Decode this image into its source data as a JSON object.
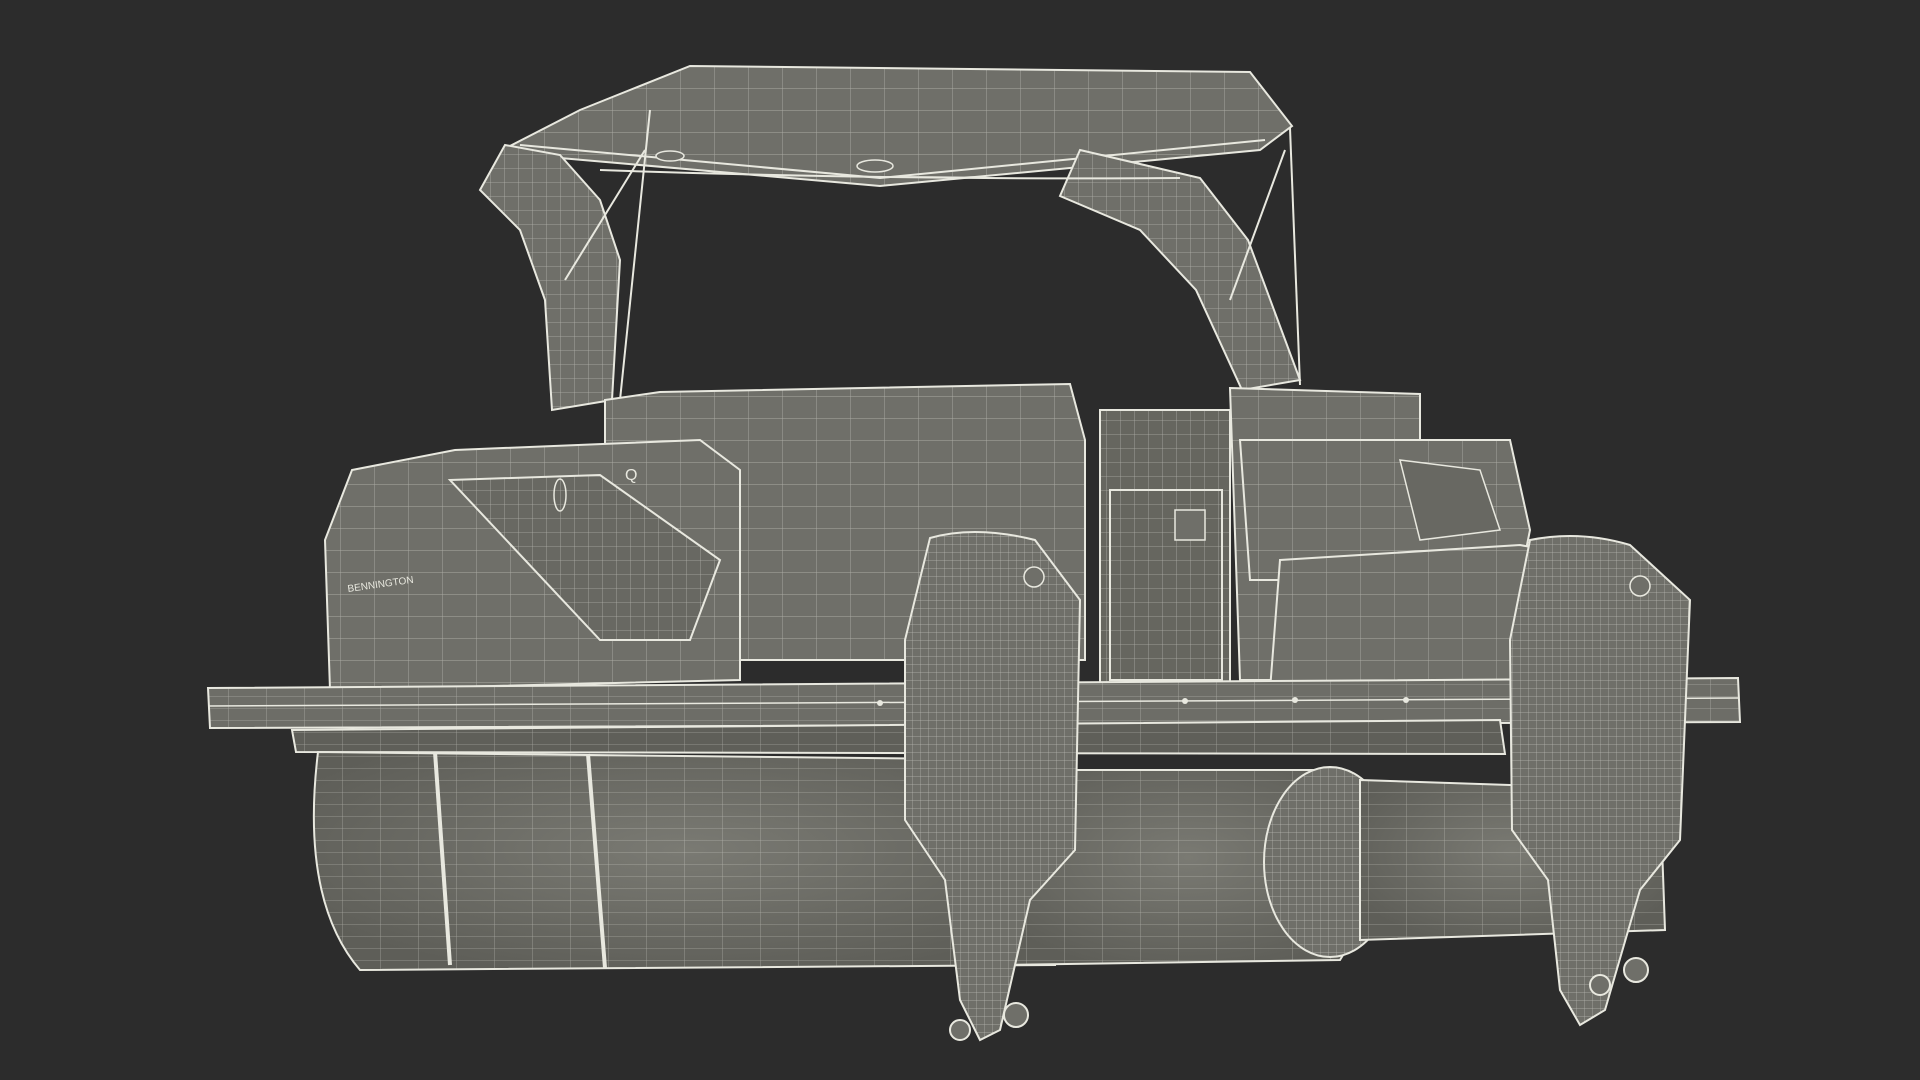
{
  "scene": {
    "background_color": "#2c2c2c",
    "model_fill_color": "#6f6f69",
    "wireframe_color": "#e8e8df",
    "hull_brand_text": "BENNINGTON",
    "hull_badge_text": "Q"
  }
}
